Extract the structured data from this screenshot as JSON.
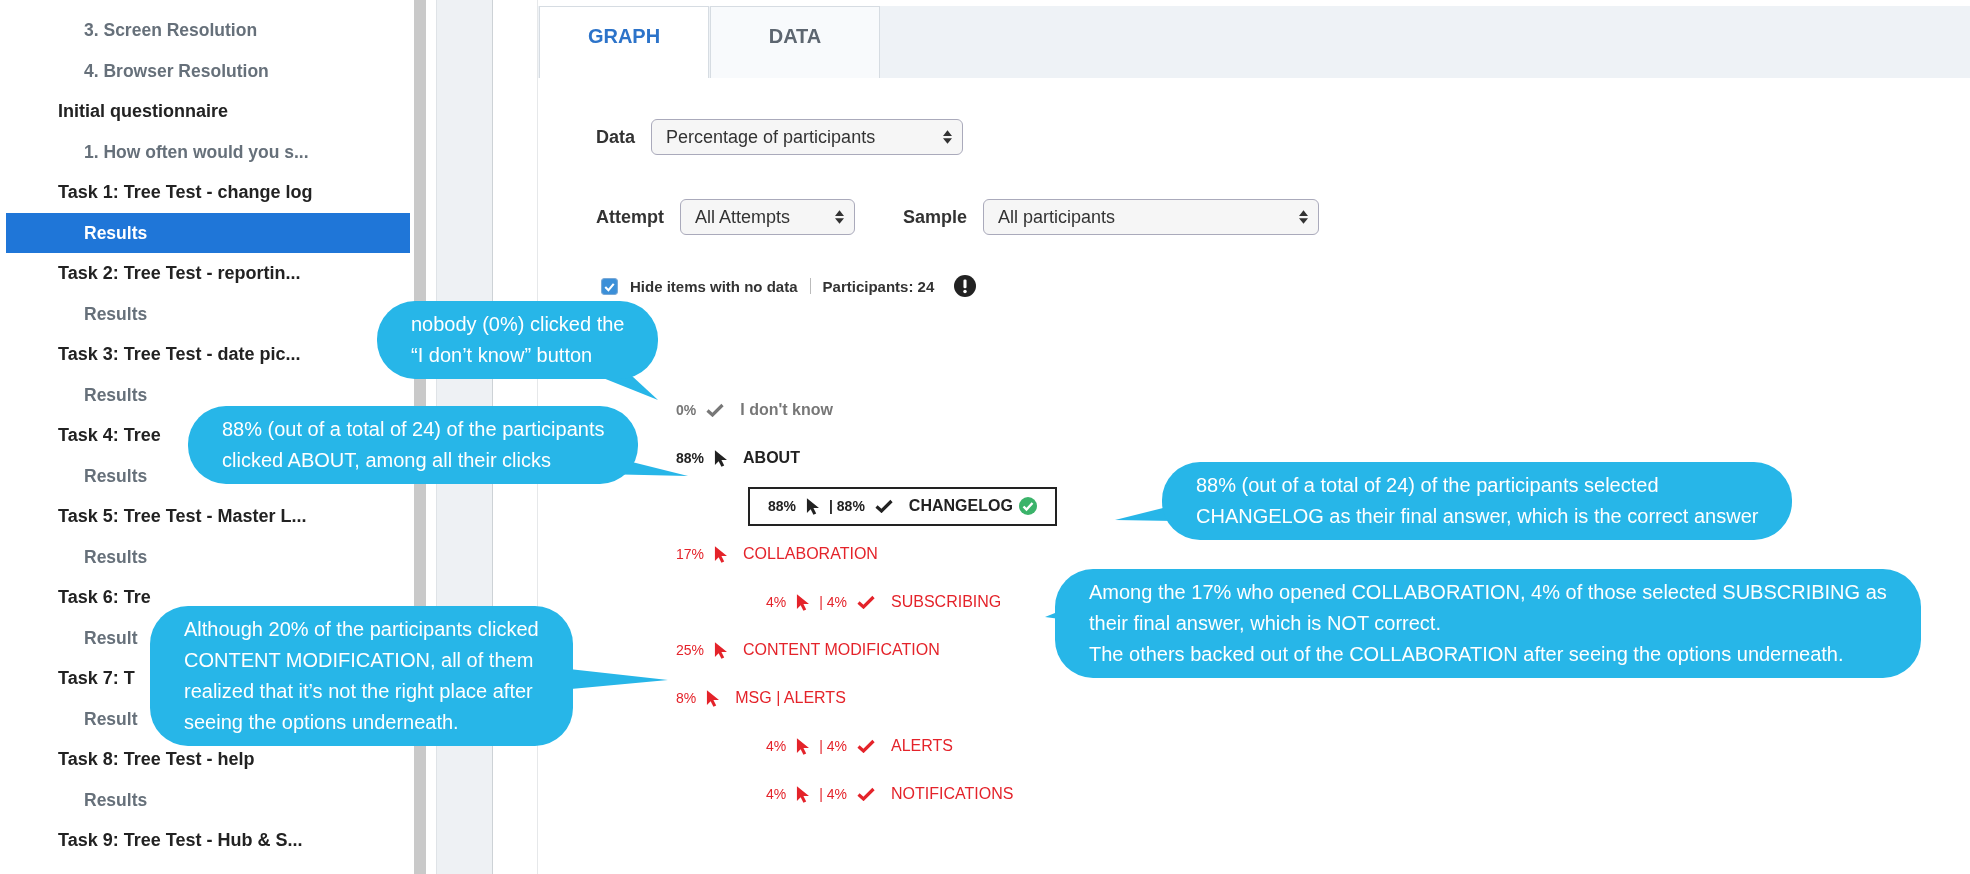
{
  "sidebar": {
    "items": [
      {
        "kind": "entry",
        "label": "3. Screen Resolution",
        "selected": false
      },
      {
        "kind": "entry",
        "label": "4. Browser Resolution",
        "selected": false
      },
      {
        "kind": "heading",
        "label": "Initial questionnaire",
        "selected": false
      },
      {
        "kind": "entry",
        "label": "1. How often would you s...",
        "selected": false
      },
      {
        "kind": "heading",
        "label": "Task 1: Tree Test - change log",
        "selected": false
      },
      {
        "kind": "entry",
        "label": "Results",
        "selected": true
      },
      {
        "kind": "heading",
        "label": "Task 2: Tree Test - reportin...",
        "selected": false
      },
      {
        "kind": "entry",
        "label": "Results",
        "selected": false
      },
      {
        "kind": "heading",
        "label": "Task 3: Tree Test - date pic...",
        "selected": false
      },
      {
        "kind": "entry",
        "label": "Results",
        "selected": false
      },
      {
        "kind": "heading",
        "label": "Task 4: Tree",
        "selected": false
      },
      {
        "kind": "entry",
        "label": "Results",
        "selected": false
      },
      {
        "kind": "heading",
        "label": "Task 5: Tree Test - Master L...",
        "selected": false
      },
      {
        "kind": "entry",
        "label": "Results",
        "selected": false
      },
      {
        "kind": "heading",
        "label": "Task 6: Tre",
        "selected": false
      },
      {
        "kind": "entry",
        "label": "Result",
        "selected": false
      },
      {
        "kind": "heading",
        "label": "Task 7: T",
        "selected": false
      },
      {
        "kind": "entry",
        "label": "Result",
        "selected": false
      },
      {
        "kind": "heading",
        "label": "Task 8: Tree Test - help",
        "selected": false
      },
      {
        "kind": "entry",
        "label": "Results",
        "selected": false
      },
      {
        "kind": "heading",
        "label": "Task 9: Tree Test - Hub & S...",
        "selected": false
      }
    ]
  },
  "tabs": [
    {
      "label": "GRAPH",
      "selected": true
    },
    {
      "label": "DATA",
      "selected": false
    }
  ],
  "filters": {
    "data": {
      "label": "Data",
      "value": "Percentage of participants"
    },
    "attempt": {
      "label": "Attempt",
      "value": "All Attempts"
    },
    "sample": {
      "label": "Sample",
      "value": "All participants"
    },
    "hide_empty": {
      "label": "Hide items with no data",
      "checked": true
    },
    "participants": "Participants: 24"
  },
  "tree": [
    {
      "kind": "skip",
      "color": "#777777",
      "clicked": "0%",
      "label": "I don't know"
    },
    {
      "kind": "node",
      "color": "#222222",
      "clicked": "88%",
      "label": "ABOUT",
      "children": [
        {
          "kind": "answer",
          "color": "#222222",
          "correct": true,
          "clicked": "88%",
          "chosen": "| 88%",
          "label": "CHANGELOG"
        }
      ]
    },
    {
      "kind": "node",
      "color": "#e4232a",
      "clicked": "17%",
      "label": "COLLABORATION",
      "children": [
        {
          "kind": "answer",
          "color": "#e4232a",
          "correct": false,
          "clicked": "4%",
          "chosen": "| 4%",
          "label": "SUBSCRIBING"
        }
      ]
    },
    {
      "kind": "node",
      "color": "#e4232a",
      "clicked": "25%",
      "label": "CONTENT MODIFICATION"
    },
    {
      "kind": "node",
      "color": "#e4232a",
      "clicked": "8%",
      "label": "MSG | ALERTS",
      "children": [
        {
          "kind": "answer",
          "color": "#e4232a",
          "correct": false,
          "clicked": "4%",
          "chosen": "| 4%",
          "label": "ALERTS"
        },
        {
          "kind": "answer",
          "color": "#e4232a",
          "correct": false,
          "clicked": "4%",
          "chosen": "| 4%",
          "label": "NOTIFICATIONS"
        }
      ]
    }
  ],
  "callouts": [
    {
      "text": "nobody (0%) clicked the\n“I don’t know” button"
    },
    {
      "text": "88% (out of a total of 24) of the participants\nclicked ABOUT, among all their clicks"
    },
    {
      "text": "88% (out of a total of 24) of the participants selected\nCHANGELOG as their final answer, which is the correct answer"
    },
    {
      "text": "Among the 17% who opened COLLABORATION, 4% of those selected SUBSCRIBING as\ntheir final answer, which is NOT correct.\nThe others backed out of the COLLABORATION after seeing the options underneath."
    },
    {
      "text": "Although 20% of the participants clicked\nCONTENT MODIFICATION, all of them\nrealized that it’s not the right place after\nseeing the options underneath."
    }
  ]
}
